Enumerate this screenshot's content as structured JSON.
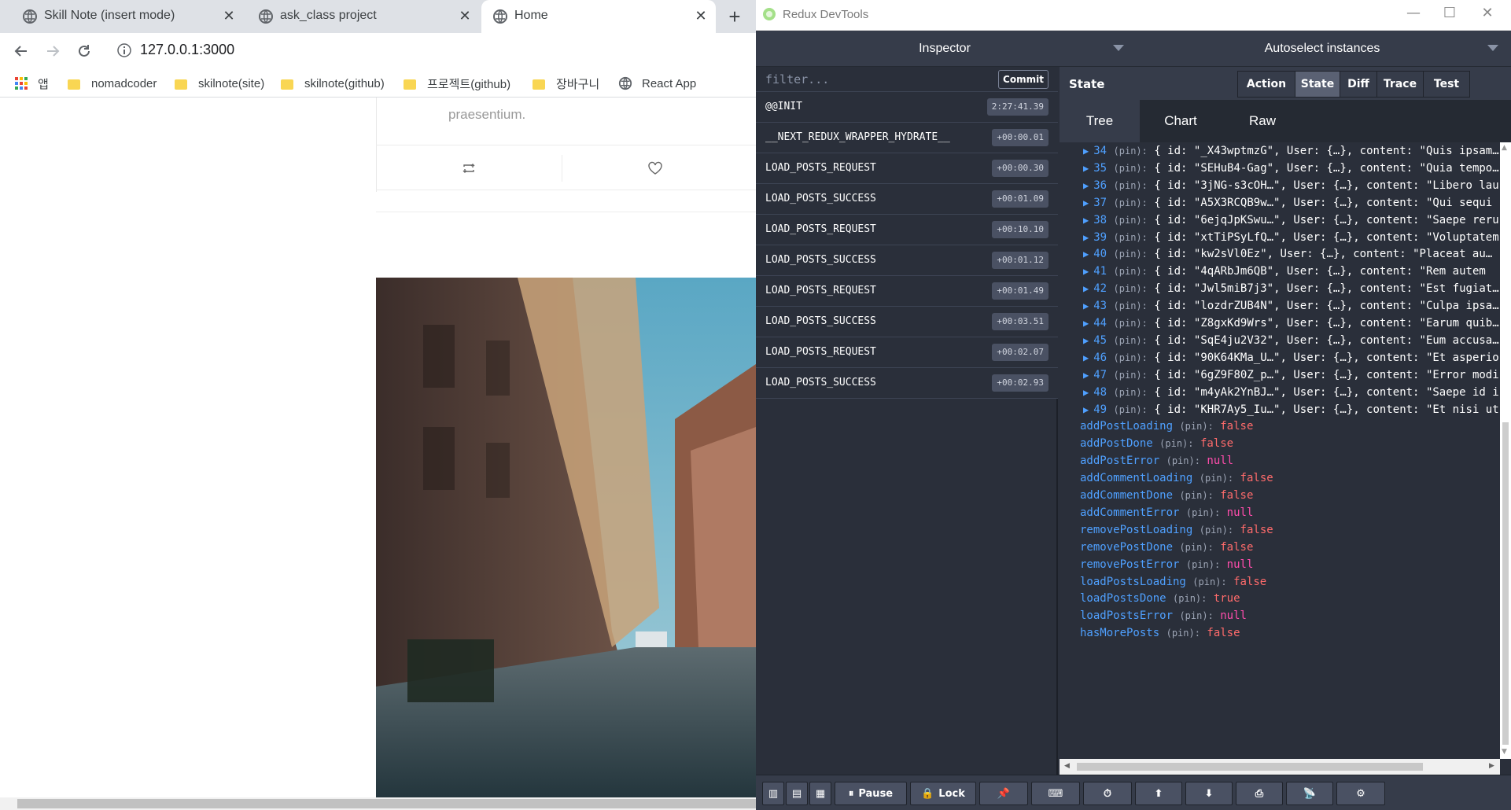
{
  "browser": {
    "tabs": [
      {
        "label": "Skill Note (insert mode)",
        "active": false
      },
      {
        "label": "ask_class project",
        "active": false
      },
      {
        "label": "Home",
        "active": true
      }
    ],
    "url": "127.0.0.1:3000",
    "bookmarks": [
      "앱",
      "nomadcoder",
      "skilnote(site)",
      "skilnote(github)",
      "프로젝트(github)",
      "장바구니",
      "React App"
    ],
    "page": {
      "post_text": "praesentium.",
      "image_alt": "street photo"
    }
  },
  "devtools": {
    "window_title": "Redux DevTools",
    "header_left": "Inspector",
    "header_right": "Autoselect instances",
    "filter_placeholder": "filter...",
    "commit_label": "Commit",
    "actions": [
      {
        "name": "@@INIT",
        "time": "2:27:41.39"
      },
      {
        "name": "__NEXT_REDUX_WRAPPER_HYDRATE__",
        "time": "+00:00.01"
      },
      {
        "name": "LOAD_POSTS_REQUEST",
        "time": "+00:00.30"
      },
      {
        "name": "LOAD_POSTS_SUCCESS",
        "time": "+00:01.09"
      },
      {
        "name": "LOAD_POSTS_REQUEST",
        "time": "+00:10.10"
      },
      {
        "name": "LOAD_POSTS_SUCCESS",
        "time": "+00:01.12"
      },
      {
        "name": "LOAD_POSTS_REQUEST",
        "time": "+00:01.49"
      },
      {
        "name": "LOAD_POSTS_SUCCESS",
        "time": "+00:03.51"
      },
      {
        "name": "LOAD_POSTS_REQUEST",
        "time": "+00:02.07"
      },
      {
        "name": "LOAD_POSTS_SUCCESS",
        "time": "+00:02.93"
      }
    ],
    "state_label": "State",
    "mode_buttons": [
      "Action",
      "State",
      "Diff",
      "Trace",
      "Test"
    ],
    "selected_mode": "State",
    "sub_tabs": [
      "Tree",
      "Chart",
      "Raw"
    ],
    "selected_sub_tab": "Tree",
    "tree_items": [
      {
        "index": "34",
        "id": "\"_X43wptmzG\"",
        "content": "\"Quis ipsam…"
      },
      {
        "index": "35",
        "id": "\"SEHuB4-Gag\"",
        "content": "\"Quia tempo…"
      },
      {
        "index": "36",
        "id": "\"3jNG-s3cOH…\"",
        "content": "\"Libero lau"
      },
      {
        "index": "37",
        "id": "\"A5X3RCQB9w…\"",
        "content": "\"Qui sequi"
      },
      {
        "index": "38",
        "id": "\"6ejqJpKSwu…\"",
        "content": "\"Saepe reru"
      },
      {
        "index": "39",
        "id": "\"xtTiPSyLfQ…\"",
        "content": "\"Voluptatem"
      },
      {
        "index": "40",
        "id": "\"kw2sVl0Ez\"",
        "content": "\"Placeat au…"
      },
      {
        "index": "41",
        "id": "\"4qARbJm6QB\"",
        "content": "\"Rem autem"
      },
      {
        "index": "42",
        "id": "\"Jwl5miB7j3\"",
        "content": "\"Est fugiat…"
      },
      {
        "index": "43",
        "id": "\"lozdrZUB4N\"",
        "content": "\"Culpa ipsa…"
      },
      {
        "index": "44",
        "id": "\"Z8gxKd9Wrs\"",
        "content": "\"Earum quib…"
      },
      {
        "index": "45",
        "id": "\"SqE4ju2V32\"",
        "content": "\"Eum accusa…"
      },
      {
        "index": "46",
        "id": "\"90K64KMa_U…\"",
        "content": "\"Et asperio"
      },
      {
        "index": "47",
        "id": "\"6gZ9F80Z_p…\"",
        "content": "\"Error modi"
      },
      {
        "index": "48",
        "id": "\"m4yAk2YnBJ…\"",
        "content": "\"Saepe id i"
      },
      {
        "index": "49",
        "id": "\"KHR7Ay5_Iu…\"",
        "content": "\"Et nisi ut"
      }
    ],
    "tree_item_text": {
      "pin": "(pin):",
      "user": "User: {…}, content:"
    },
    "state_props": [
      {
        "key": "addPostLoading",
        "value": "false",
        "kind": "bool"
      },
      {
        "key": "addPostDone",
        "value": "false",
        "kind": "bool"
      },
      {
        "key": "addPostError",
        "value": "null",
        "kind": "null"
      },
      {
        "key": "addCommentLoading",
        "value": "false",
        "kind": "bool"
      },
      {
        "key": "addCommentDone",
        "value": "false",
        "kind": "bool"
      },
      {
        "key": "addCommentError",
        "value": "null",
        "kind": "null"
      },
      {
        "key": "removePostLoading",
        "value": "false",
        "kind": "bool"
      },
      {
        "key": "removePostDone",
        "value": "false",
        "kind": "bool"
      },
      {
        "key": "removePostError",
        "value": "null",
        "kind": "null"
      },
      {
        "key": "loadPostsLoading",
        "value": "false",
        "kind": "bool"
      },
      {
        "key": "loadPostsDone",
        "value": "true",
        "kind": "bool"
      },
      {
        "key": "loadPostsError",
        "value": "null",
        "kind": "null"
      },
      {
        "key": "hasMorePosts",
        "value": "false",
        "kind": "bool"
      }
    ],
    "bottom_buttons": [
      "Pause",
      "Lock"
    ]
  },
  "colors": {
    "devtools_bg": "#2a2f3a",
    "key_blue": "#4fa0ff",
    "bool_red": "#ff6b6b",
    "null_pink": "#ff4dac"
  }
}
